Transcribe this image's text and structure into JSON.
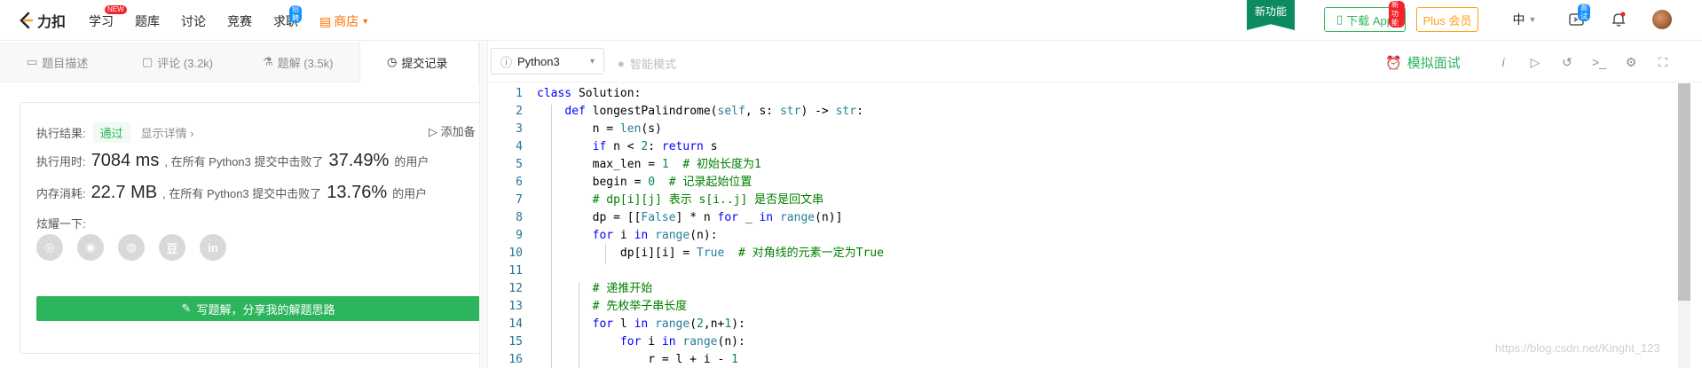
{
  "nav": {
    "logo_text": "力扣",
    "items": [
      {
        "label": "学习",
        "badge": "NEW"
      },
      {
        "label": "题库"
      },
      {
        "label": "讨论"
      },
      {
        "label": "竞赛"
      },
      {
        "label": "求职",
        "badge": "招聘"
      }
    ],
    "shop_label": "商店",
    "new_feature": "新功能",
    "download_label": "下载 App",
    "download_badge": "新功能",
    "plus_label": "Plus 会员",
    "lang_label": "中",
    "interview_badge": "面试"
  },
  "tabs": [
    {
      "label": "题目描述",
      "icon": "doc-icon"
    },
    {
      "label": "评论 (3.2k)",
      "icon": "comment-icon"
    },
    {
      "label": "题解 (3.5k)",
      "icon": "flask-icon"
    },
    {
      "label": "提交记录",
      "icon": "clock-icon"
    }
  ],
  "result": {
    "result_label": "执行结果:",
    "status": "通过",
    "detail_link": "显示详情 ›",
    "add_note": "添加备",
    "runtime_label": "执行用时:",
    "runtime_value": "7084 ms",
    "runtime_text": ", 在所有 Python3 提交中击败了",
    "runtime_pct": "37.49%",
    "runtime_suffix": "的用户",
    "memory_label": "内存消耗:",
    "memory_value": "22.7 MB",
    "memory_text": ", 在所有 Python3 提交中击败了",
    "memory_pct": "13.76%",
    "memory_suffix": "的用户",
    "share_label": "炫耀一下:",
    "share_icons": [
      "wechat-icon",
      "weibo-icon",
      "qq-icon",
      "douban-icon",
      "linkedin-icon"
    ],
    "share_glyphs": [
      "◎",
      "◉",
      "◍",
      "豆",
      "in"
    ],
    "write_button": "写题解，分享我的解题思路"
  },
  "editor": {
    "language": "Python3",
    "smart_mode": "智能模式",
    "mock_interview": "模拟面试",
    "lines": [
      {
        "n": "1",
        "code": "class Solution:"
      },
      {
        "n": "2",
        "code": "    def longestPalindrome(self, s: str) -> str:"
      },
      {
        "n": "3",
        "code": "        n = len(s)"
      },
      {
        "n": "4",
        "code": "        if n < 2: return s"
      },
      {
        "n": "5",
        "code": "        max_len = 1  # 初始长度为1"
      },
      {
        "n": "6",
        "code": "        begin = 0  # 记录起始位置"
      },
      {
        "n": "7",
        "code": "        # dp[i][j] 表示 s[i..j] 是否是回文串"
      },
      {
        "n": "8",
        "code": "        dp = [[False] * n for _ in range(n)]"
      },
      {
        "n": "9",
        "code": "        for i in range(n):"
      },
      {
        "n": "10",
        "code": "            dp[i][i] = True  # 对角线的元素一定为True"
      },
      {
        "n": "11",
        "code": ""
      },
      {
        "n": "12",
        "code": "        # 递推开始"
      },
      {
        "n": "13",
        "code": "        # 先枚举子串长度"
      },
      {
        "n": "14",
        "code": "        for l in range(2,n+1):"
      },
      {
        "n": "15",
        "code": "            for i in range(n):"
      },
      {
        "n": "16",
        "code": "                r = l + i - 1"
      }
    ]
  },
  "watermark": "https://blog.csdn.net/Kinght_123",
  "colors": {
    "accent_green": "#2db55d",
    "orange": "#ffa116",
    "shop_orange": "#ff6f00"
  }
}
